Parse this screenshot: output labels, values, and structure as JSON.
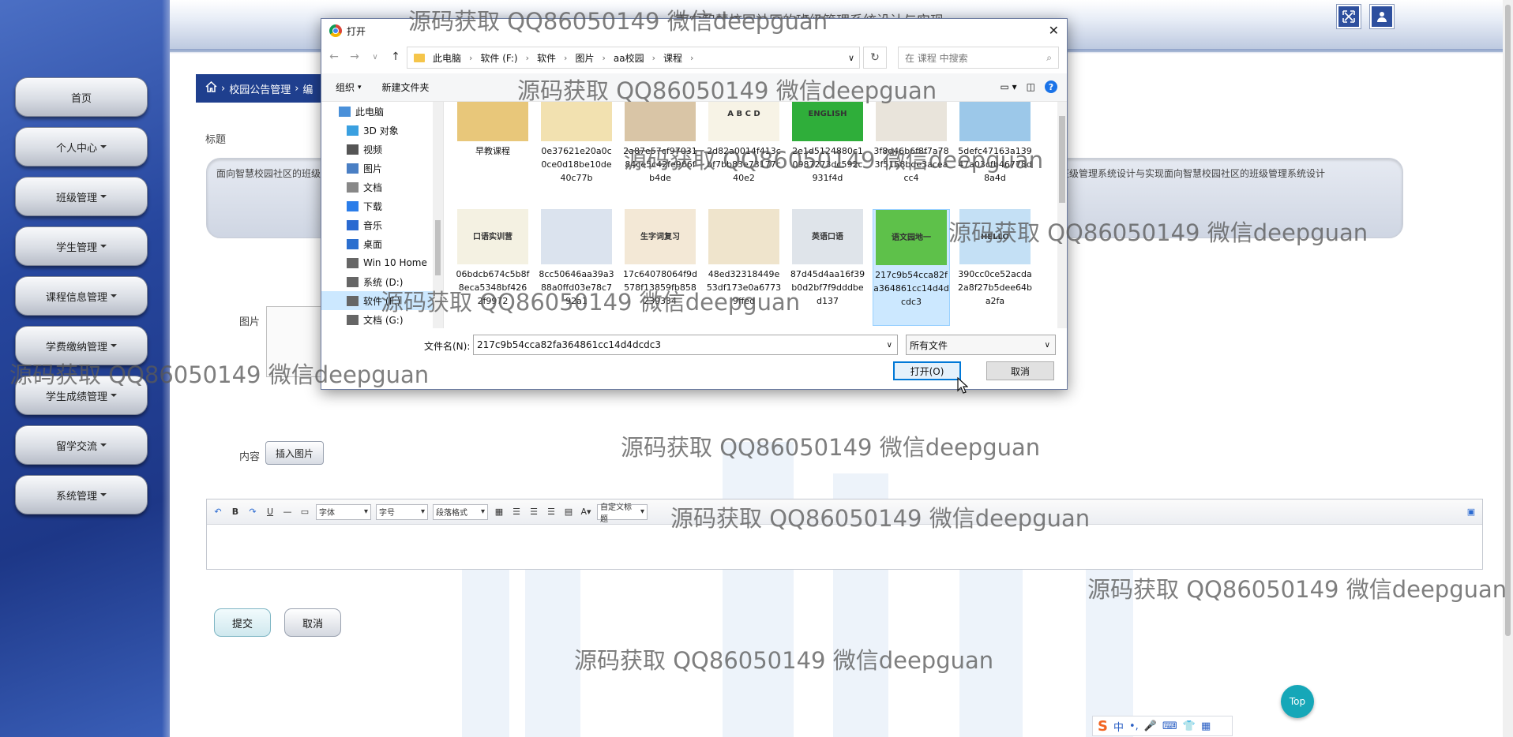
{
  "sidebar": {
    "items": [
      {
        "label": "首页",
        "has_dropdown": false
      },
      {
        "label": "个人中心",
        "has_dropdown": true
      },
      {
        "label": "班级管理",
        "has_dropdown": true
      },
      {
        "label": "学生管理",
        "has_dropdown": true
      },
      {
        "label": "课程信息管理",
        "has_dropdown": true
      },
      {
        "label": "学费缴纳管理",
        "has_dropdown": true
      },
      {
        "label": "学生成绩管理",
        "has_dropdown": true
      },
      {
        "label": "留学交流",
        "has_dropdown": true
      },
      {
        "label": "系统管理",
        "has_dropdown": true
      }
    ]
  },
  "header": {
    "system_title": "面向智慧校园社区的班级管理系统设计与实现",
    "icons": [
      "fullscreen-icon",
      "user-icon"
    ]
  },
  "breadcrumb": {
    "home_icon": "home-icon",
    "items": [
      "校园公告管理",
      "编"
    ]
  },
  "form": {
    "title_label": "标题",
    "title_value": "面向智慧校园社区的班级管理系统设计与实现面向智慧校园社区的班级管理系统设计与实现面向智慧校园社区的班级管理系统设计与实现面向智慧校园社区的班级管理系统设计与实现面向智慧校园社区的班级管理系统设计与实现面向智慧校园社区的班级管理系统设计",
    "image_label": "图片",
    "content_label": "内容",
    "insert_image_button": "插入图片",
    "editor_toolbar": {
      "font_family": "字体",
      "font_size": "字号",
      "paragraph": "段落格式",
      "custom_title": "自定义标题"
    },
    "submit_button": "提交",
    "cancel_button": "取消"
  },
  "top_button": "Top",
  "ime_bar": {
    "mode": "中"
  },
  "dialog": {
    "title": "打开",
    "path": [
      "此电脑",
      "软件 (F:)",
      "软件",
      "图片",
      "aa校园",
      "课程"
    ],
    "search_placeholder": "在 课程 中搜索",
    "organize": "组织",
    "new_folder": "新建文件夹",
    "nav_items": [
      {
        "label": "此电脑",
        "icon": "pc-icon",
        "selected": false
      },
      {
        "label": "3D 对象",
        "icon": "cube-icon",
        "selected": false
      },
      {
        "label": "视频",
        "icon": "video-icon",
        "selected": false
      },
      {
        "label": "图片",
        "icon": "picture-icon",
        "selected": false
      },
      {
        "label": "文档",
        "icon": "document-icon",
        "selected": false
      },
      {
        "label": "下载",
        "icon": "download-icon",
        "selected": false
      },
      {
        "label": "音乐",
        "icon": "music-icon",
        "selected": false
      },
      {
        "label": "桌面",
        "icon": "desktop-icon",
        "selected": false
      },
      {
        "label": "Win 10 Home",
        "icon": "drive-icon",
        "selected": false
      },
      {
        "label": "系统 (D:)",
        "icon": "drive-icon",
        "selected": false
      },
      {
        "label": "软件 (F:)",
        "icon": "drive-icon",
        "selected": true
      },
      {
        "label": "文档 (G:)",
        "icon": "drive-icon",
        "selected": false
      }
    ],
    "files": [
      {
        "name": "早教课程",
        "thumb_color": "#e8c77a",
        "thumb_text": ""
      },
      {
        "name": "0e37621e20a0c0ce0d18be10de40c77b",
        "thumb_color": "#f2e1b0",
        "thumb_text": ""
      },
      {
        "name": "2a87e57cf9703184ce5c42fe966fb4de",
        "thumb_color": "#d9c5a6",
        "thumb_text": ""
      },
      {
        "name": "2d82a0014f413cbf7bb83e73177c40e2",
        "thumb_color": "#f7f3e6",
        "thumb_text": "A B C D"
      },
      {
        "name": "2e1d5124880c10987273dc592c931f4d",
        "thumb_color": "#2fae3a",
        "thumb_text": "ENGLISH"
      },
      {
        "name": "3f8d46b6f8f7a783f5158bde3aceacc4",
        "thumb_color": "#e9e4db",
        "thumb_text": ""
      },
      {
        "name": "5defc47163a13947a03cfb46778d8a4d",
        "thumb_color": "#9cc8e9",
        "thumb_text": ""
      },
      {
        "name": "06bdcb674c5b8f8eca5348bf426 2f9972",
        "thumb_color": "#f4f1e2",
        "thumb_text": "口语实训营"
      },
      {
        "name": "8cc50646aa39a388a0ffd03e78c792a1",
        "thumb_color": "#dbe3ee",
        "thumb_text": ""
      },
      {
        "name": "17c64078064f9d578f13859fb858239334",
        "thumb_color": "#f3e8d6",
        "thumb_text": "生字词复习"
      },
      {
        "name": "48ed32318449e53df173e0a67739ffed",
        "thumb_color": "#efe4cc",
        "thumb_text": ""
      },
      {
        "name": "87d45d4aa16f39b0d2bf7f9dddbed137",
        "thumb_color": "#dfe4ea",
        "thumb_text": "英语口语"
      },
      {
        "name": "217c9b54cca82fa364861cc14d4dcdc3",
        "thumb_color": "#5ec14a",
        "thumb_text": "语文园地一",
        "selected": true
      },
      {
        "name": "390cc0ce52acda2a8f27b5dee64ba2fa",
        "thumb_color": "#c4e0f5",
        "thumb_text": "HELLO"
      }
    ],
    "filename_label": "文件名(N):",
    "filename_value": "217c9b54cca82fa364861cc14d4dcdc3",
    "filetype_value": "所有文件",
    "open_button": "打开(O)",
    "cancel_button": "取消"
  },
  "watermarks": [
    "源码获取 QQ86050149 微信deepguan",
    "源码获取 QQ86050149 微信deepguan",
    "源码获取 QQ86050149 微信deepguan",
    "源码获取 QQ86050149 微信deepguan",
    "源码获取 QQ86050149 微信deepguan",
    "源码获取 QQ86050149 微信deepguan",
    "源码获取 QQ86050149 微信deepguan",
    "源码获取 QQ86050149 微信deepguan",
    "源码获取 QQ86050149 微信deepguan",
    "源码获取 QQ86050149 微信deepguan"
  ],
  "colors": {
    "sidebar_bg": "#27479e",
    "breadcrumb_bg": "#1f3f8e",
    "dialog_selection": "#cce8ff",
    "top_button": "#16a7b8"
  }
}
